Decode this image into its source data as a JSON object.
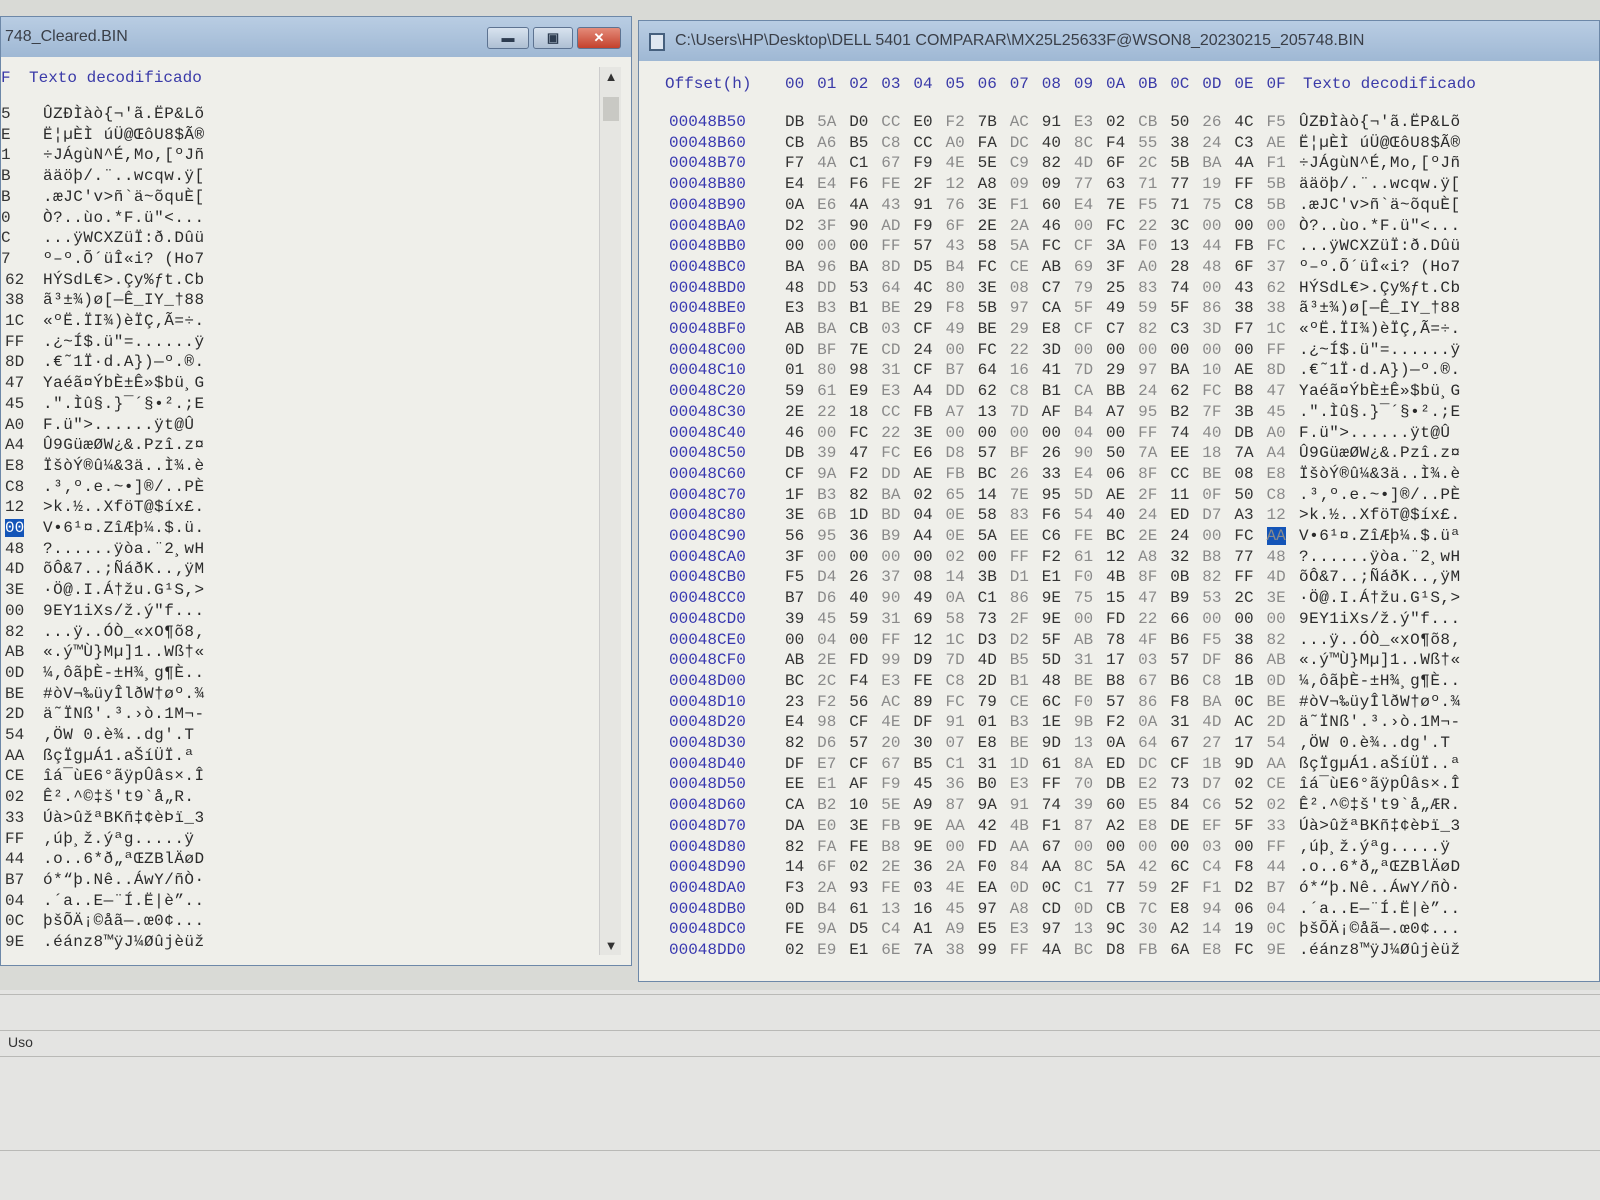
{
  "left_window": {
    "title": "748_Cleared.BIN",
    "header_col": "F",
    "header_text": "Texto decodificado",
    "rows": [
      {
        "b": "5",
        "t": "ÛZÐÌàò{¬'ã.ËP&Lõ"
      },
      {
        "b": "E",
        "t": "Ë¦µÈÌ úÜ@ŒôU8$Ã®"
      },
      {
        "b": "1",
        "t": "÷JÁgùN^É,Mo,[ºJñ"
      },
      {
        "b": "B",
        "t": "ääöþ/.¨..wcqw.ÿ["
      },
      {
        "b": "B",
        "t": ".æJC'v>ñ`ä~õquÈ["
      },
      {
        "b": "0",
        "t": "Ò?..ùo.*F.ü\"<..."
      },
      {
        "b": "C",
        "t": "...ÿWCXZüÏ:ð.Dûü"
      },
      {
        "b": "7",
        "t": "º–º.Õ´üÎ«i? (Ho7"
      },
      {
        "b": "62",
        "t": "HÝSdL€>.Çy%ƒt.Cb"
      },
      {
        "b": "38",
        "t": "ã³±¾)ø[—Ê_IY_†88"
      },
      {
        "b": "1C",
        "t": "«ºË.ÏI¾)èÏÇ‚Ã=÷."
      },
      {
        "b": "FF",
        "t": ".¿~Í$.ü\"=......ÿ"
      },
      {
        "b": "8D",
        "t": ".€˜1Ï·d.A})—º.®."
      },
      {
        "b": "47",
        "t": "Yaéã¤ÝbÈ±Ê»$bü¸G"
      },
      {
        "b": "45",
        "t": ".\".Ìû§.}¯´§•².;E"
      },
      {
        "b": "A0",
        "t": "F.ü\">......ÿt@Û"
      },
      {
        "b": "A4",
        "t": "Û9GüæØW¿&.Pzî.z¤"
      },
      {
        "b": "E8",
        "t": "ÏšòÝ®û¼&3ä..Ì¾.è"
      },
      {
        "b": "C8",
        "t": ".³‚º.e.~•]®/..PÈ"
      },
      {
        "b": "12",
        "t": ">k.½..XföT@$íx£."
      },
      {
        "b": "00",
        "t": "V•6¹¤.ZîÆþ¼.$.ü."
      },
      {
        "b": "48",
        "t": "?......ÿòa.¨2¸wH"
      },
      {
        "b": "4D",
        "t": "õÔ&7..;ÑáðK..‚ÿM"
      },
      {
        "b": "3E",
        "t": "·Ö@.I.Á†žu.G¹S,>"
      },
      {
        "b": "00",
        "t": "9EY1iXs/ž.ý\"f..."
      },
      {
        "b": "82",
        "t": "...ÿ..ÓÒ_«xO¶õ8‚"
      },
      {
        "b": "AB",
        "t": "«.ý™Ù}Mµ]1..Wß†«"
      },
      {
        "b": "0D",
        "t": "¼‚ôãþÈ-±H¾¸g¶È.."
      },
      {
        "b": "BE",
        "t": "#òV¬‰üyÎlðW†øº.¾"
      },
      {
        "b": "2D",
        "t": "ä˜ÏNß'.³.›ò.1M¬-"
      },
      {
        "b": "54",
        "t": "‚ÖW 0.è¾..dg'.T"
      },
      {
        "b": "AA",
        "t": "ßçÏgµÁ1.aŠíÜÏ.ª"
      },
      {
        "b": "CE",
        "t": "îá¯ùE6°ãÿpÛâs×.Î"
      },
      {
        "b": "02",
        "t": "Ê².^©‡š't9`å„R."
      },
      {
        "b": "33",
        "t": "Úà>ûžªBKñ‡¢èÞï_3"
      },
      {
        "b": "FF",
        "t": "‚úþ¸ž.ýªg.....ÿ"
      },
      {
        "b": "44",
        "t": ".o..6*ð„ªŒZBlÄøD"
      },
      {
        "b": "B7",
        "t": "ó*“þ.Nê..ÁwY/ñÒ·"
      },
      {
        "b": "04",
        "t": ".´a..E—¨Í.Ë|è”.."
      },
      {
        "b": "0C",
        "t": "þšÕÄ¡©åã—.œ0¢..."
      },
      {
        "b": "9E",
        "t": ".éánz8™ÿJ¼Øûjèüž"
      }
    ],
    "selected_row": 20
  },
  "right_window": {
    "title": "C:\\Users\\HP\\Desktop\\DELL 5401 COMPARAR\\MX25L25633F@WSON8_20230215_205748.BIN",
    "offset_header": "Offset(h)",
    "text_header": "Texto decodificado",
    "columns": [
      "00",
      "01",
      "02",
      "03",
      "04",
      "05",
      "06",
      "07",
      "08",
      "09",
      "0A",
      "0B",
      "0C",
      "0D",
      "0E",
      "0F"
    ],
    "selected": {
      "row": 20,
      "col": 15
    },
    "rows": [
      {
        "o": "00048B50",
        "h": "DB 5A D0 CC E0 F2 7B AC 91 E3 02 CB 50 26 4C F5",
        "t": "ÛZÐÌàò{¬'ã.ËP&Lõ"
      },
      {
        "o": "00048B60",
        "h": "CB A6 B5 C8 CC A0 FA DC 40 8C F4 55 38 24 C3 AE",
        "t": "Ë¦µÈÌ úÜ@ŒôU8$Ã®"
      },
      {
        "o": "00048B70",
        "h": "F7 4A C1 67 F9 4E 5E C9 82 4D 6F 2C 5B BA 4A F1",
        "t": "÷JÁgùN^É,Mo,[ºJñ"
      },
      {
        "o": "00048B80",
        "h": "E4 E4 F6 FE 2F 12 A8 09 09 77 63 71 77 19 FF 5B",
        "t": "ääöþ/.¨..wcqw.ÿ["
      },
      {
        "o": "00048B90",
        "h": "0A E6 4A 43 91 76 3E F1 60 E4 7E F5 71 75 C8 5B",
        "t": ".æJC'v>ñ`ä~õquÈ["
      },
      {
        "o": "00048BA0",
        "h": "D2 3F 90 AD F9 6F 2E 2A 46 00 FC 22 3C 00 00 00",
        "t": "Ò?..ùo.*F.ü\"<..."
      },
      {
        "o": "00048BB0",
        "h": "00 00 00 FF 57 43 58 5A FC CF 3A F0 13 44 FB FC",
        "t": "...ÿWCXZüÏ:ð.Dûü"
      },
      {
        "o": "00048BC0",
        "h": "BA 96 BA 8D D5 B4 FC CE AB 69 3F A0 28 48 6F 37",
        "t": "º–º.Õ´üÎ«i? (Ho7"
      },
      {
        "o": "00048BD0",
        "h": "48 DD 53 64 4C 80 3E 08 C7 79 25 83 74 00 43 62",
        "t": "HÝSdL€>.Çy%ƒt.Cb"
      },
      {
        "o": "00048BE0",
        "h": "E3 B3 B1 BE 29 F8 5B 97 CA 5F 49 59 5F 86 38 38",
        "t": "ã³±¾)ø[—Ê_IY_†88"
      },
      {
        "o": "00048BF0",
        "h": "AB BA CB 03 CF 49 BE 29 E8 CF C7 82 C3 3D F7 1C",
        "t": "«ºË.ÏI¾)èÏÇ‚Ã=÷."
      },
      {
        "o": "00048C00",
        "h": "0D BF 7E CD 24 00 FC 22 3D 00 00 00 00 00 00 FF",
        "t": ".¿~Í$.ü\"=......ÿ"
      },
      {
        "o": "00048C10",
        "h": "01 80 98 31 CF B7 64 16 41 7D 29 97 BA 10 AE 8D",
        "t": ".€˜1Ï·d.A})—º.®."
      },
      {
        "o": "00048C20",
        "h": "59 61 E9 E3 A4 DD 62 C8 B1 CA BB 24 62 FC B8 47",
        "t": "Yaéã¤ÝbÈ±Ê»$bü¸G"
      },
      {
        "o": "00048C30",
        "h": "2E 22 18 CC FB A7 13 7D AF B4 A7 95 B2 7F 3B 45",
        "t": ".\".Ìû§.}¯´§•².;E"
      },
      {
        "o": "00048C40",
        "h": "46 00 FC 22 3E 00 00 00 00 04 00 FF 74 40 DB A0",
        "t": "F.ü\">......ÿt@Û"
      },
      {
        "o": "00048C50",
        "h": "DB 39 47 FC E6 D8 57 BF 26 90 50 7A EE 18 7A A4",
        "t": "Û9GüæØW¿&.Pzî.z¤"
      },
      {
        "o": "00048C60",
        "h": "CF 9A F2 DD AE FB BC 26 33 E4 06 8F CC BE 08 E8",
        "t": "ÏšòÝ®û¼&3ä..Ì¾.è"
      },
      {
        "o": "00048C70",
        "h": "1F B3 82 BA 02 65 14 7E 95 5D AE 2F 11 0F 50 C8",
        "t": ".³‚º.e.~•]®/..PÈ"
      },
      {
        "o": "00048C80",
        "h": "3E 6B 1D BD 04 0E 58 83 F6 54 40 24 ED D7 A3 12",
        "t": ">k.½..XföT@$íx£."
      },
      {
        "o": "00048C90",
        "h": "56 95 36 B9 A4 0E 5A EE C6 FE BC 2E 24 00 FC AA",
        "t": "V•6¹¤.ZîÆþ¼.$.üª"
      },
      {
        "o": "00048CA0",
        "h": "3F 00 00 00 00 02 00 FF F2 61 12 A8 32 B8 77 48",
        "t": "?......ÿòa.¨2¸wH"
      },
      {
        "o": "00048CB0",
        "h": "F5 D4 26 37 08 14 3B D1 E1 F0 4B 8F 0B 82 FF 4D",
        "t": "õÔ&7..;ÑáðK..‚ÿM"
      },
      {
        "o": "00048CC0",
        "h": "B7 D6 40 90 49 0A C1 86 9E 75 15 47 B9 53 2C 3E",
        "t": "·Ö@.I.Á†žu.G¹S,>"
      },
      {
        "o": "00048CD0",
        "h": "39 45 59 31 69 58 73 2F 9E 00 FD 22 66 00 00 00",
        "t": "9EY1iXs/ž.ý\"f..."
      },
      {
        "o": "00048CE0",
        "h": "00 04 00 FF 12 1C D3 D2 5F AB 78 4F B6 F5 38 82",
        "t": "...ÿ..ÓÒ_«xO¶õ8‚"
      },
      {
        "o": "00048CF0",
        "h": "AB 2E FD 99 D9 7D 4D B5 5D 31 17 03 57 DF 86 AB",
        "t": "«.ý™Ù}Mµ]1..Wß†«"
      },
      {
        "o": "00048D00",
        "h": "BC 2C F4 E3 FE C8 2D B1 48 BE B8 67 B6 C8 1B 0D",
        "t": "¼‚ôãþÈ-±H¾¸g¶È.."
      },
      {
        "o": "00048D10",
        "h": "23 F2 56 AC 89 FC 79 CE 6C F0 57 86 F8 BA 0C BE",
        "t": "#òV¬‰üyÎlðW†øº.¾"
      },
      {
        "o": "00048D20",
        "h": "E4 98 CF 4E DF 91 01 B3 1E 9B F2 0A 31 4D AC 2D",
        "t": "ä˜ÏNß'.³.›ò.1M¬-"
      },
      {
        "o": "00048D30",
        "h": "82 D6 57 20 30 07 E8 BE 9D 13 0A 64 67 27 17 54",
        "t": "‚ÖW 0.è¾..dg'.T"
      },
      {
        "o": "00048D40",
        "h": "DF E7 CF 67 B5 C1 31 1D 61 8A ED DC CF 1B 9D AA",
        "t": "ßçÏgµÁ1.aŠíÜÏ..ª"
      },
      {
        "o": "00048D50",
        "h": "EE E1 AF F9 45 36 B0 E3 FF 70 DB E2 73 D7 02 CE",
        "t": "îá¯ùE6°ãÿpÛâs×.Î"
      },
      {
        "o": "00048D60",
        "h": "CA B2 10 5E A9 87 9A 91 74 39 60 E5 84 C6 52 02",
        "t": "Ê².^©‡š't9`å„ÆR."
      },
      {
        "o": "00048D70",
        "h": "DA E0 3E FB 9E AA 42 4B F1 87 A2 E8 DE EF 5F 33",
        "t": "Úà>ûžªBKñ‡¢èÞï_3"
      },
      {
        "o": "00048D80",
        "h": "82 FA FE B8 9E 00 FD AA 67 00 00 00 00 03 00 FF",
        "t": "‚úþ¸ž.ýªg.....ÿ"
      },
      {
        "o": "00048D90",
        "h": "14 6F 02 2E 36 2A F0 84 AA 8C 5A 42 6C C4 F8 44",
        "t": ".o..6*ð„ªŒZBlÄøD"
      },
      {
        "o": "00048DA0",
        "h": "F3 2A 93 FE 03 4E EA 0D 0C C1 77 59 2F F1 D2 B7",
        "t": "ó*“þ.Nê..ÁwY/ñÒ·"
      },
      {
        "o": "00048DB0",
        "h": "0D B4 61 13 16 45 97 A8 CD 0D CB 7C E8 94 06 04",
        "t": ".´a..E—¨Í.Ë|è”.."
      },
      {
        "o": "00048DC0",
        "h": "FE 9A D5 C4 A1 A9 E5 E3 97 13 9C 30 A2 14 19 0C",
        "t": "þšÕÄ¡©åã—.œ0¢..."
      },
      {
        "o": "00048DD0",
        "h": "02 E9 E1 6E 7A 38 99 FF 4A BC D8 FB 6A E8 FC 9E",
        "t": ".éánz8™ÿJ¼Øûjèüž"
      }
    ]
  },
  "status_panel": {
    "label": "Uso"
  },
  "colors": {
    "offset": "#3838b0",
    "selection": "#1455b8",
    "titlebar": "#a9c0da"
  }
}
